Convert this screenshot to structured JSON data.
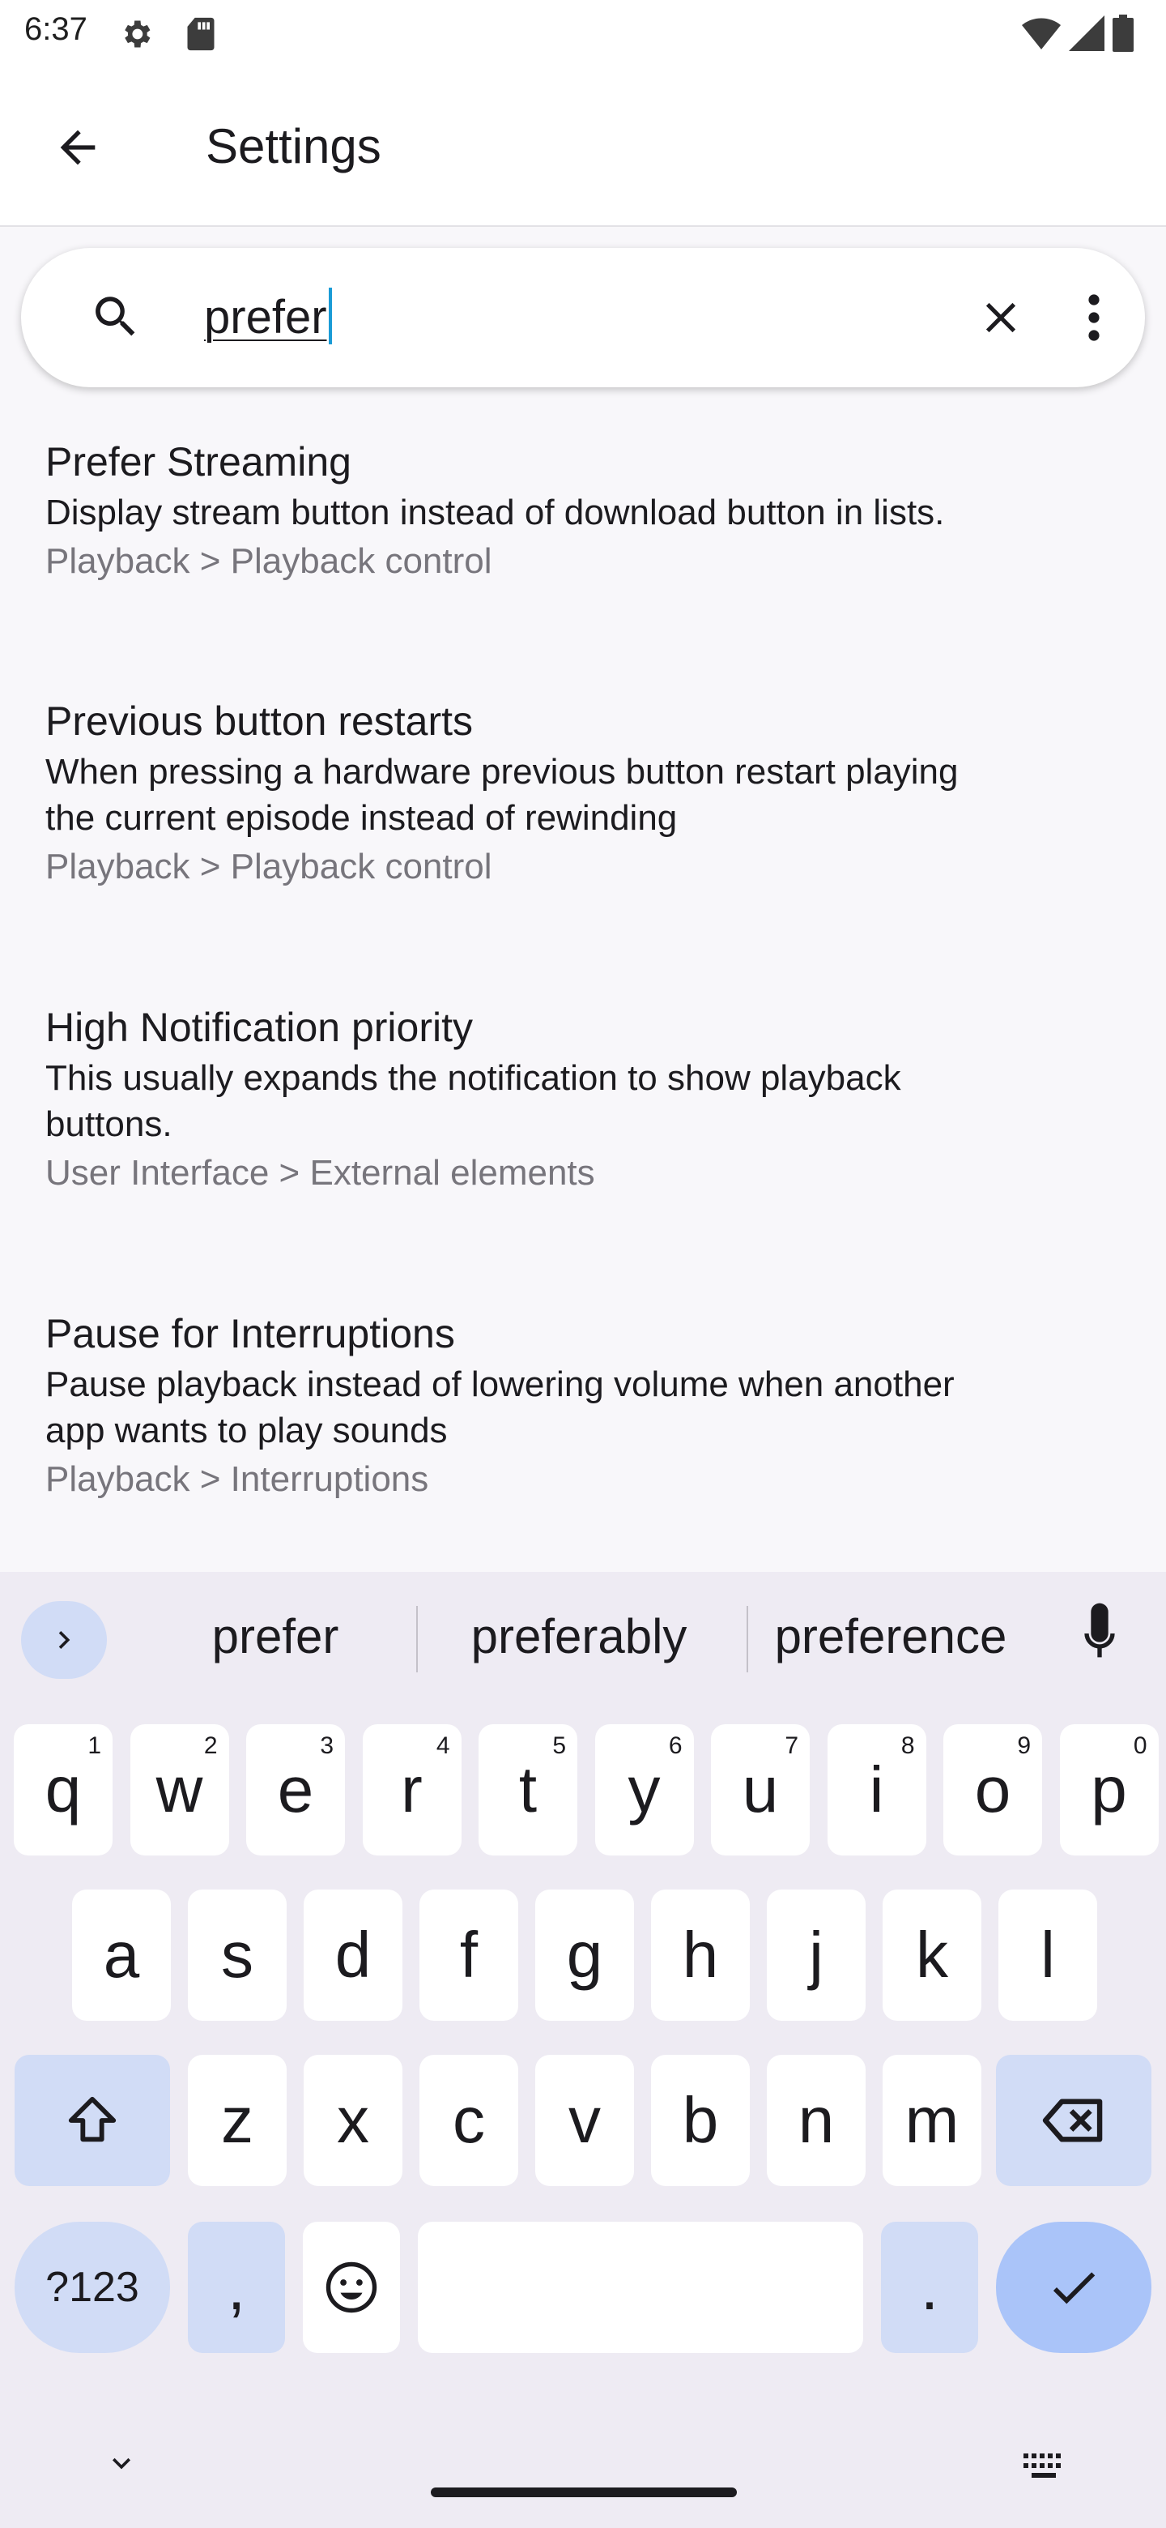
{
  "status_bar": {
    "time": "6:37",
    "icons": [
      "gear-icon",
      "sd-card-icon",
      "wifi-icon",
      "signal-icon",
      "battery-icon"
    ]
  },
  "app_bar": {
    "title": "Settings",
    "back_icon": "arrow-back-icon"
  },
  "search": {
    "query": "prefer",
    "icons": [
      "search-icon",
      "close-icon",
      "more-vert-icon"
    ]
  },
  "results": [
    {
      "title": "Prefer Streaming",
      "summary_lines": [
        "Display stream button instead of download button in lists."
      ],
      "path": "Playback > Playback control"
    },
    {
      "title": "Previous button restarts",
      "summary_lines": [
        "When pressing a hardware previous button restart playing",
        "the current episode instead of rewinding"
      ],
      "path": "Playback > Playback control"
    },
    {
      "title": "High Notification priority",
      "summary_lines": [
        "This usually expands the notification to show playback",
        "buttons."
      ],
      "path": "User Interface > External elements"
    },
    {
      "title": "Pause for Interruptions",
      "summary_lines": [
        "Pause playback instead of lowering volume when another",
        "app wants to play sounds"
      ],
      "path": "Playback > Interruptions"
    }
  ],
  "keyboard": {
    "suggestions": [
      "prefer",
      "preferably",
      "preference"
    ],
    "row1": [
      {
        "key": "q",
        "hint": "1"
      },
      {
        "key": "w",
        "hint": "2"
      },
      {
        "key": "e",
        "hint": "3"
      },
      {
        "key": "r",
        "hint": "4"
      },
      {
        "key": "t",
        "hint": "5"
      },
      {
        "key": "y",
        "hint": "6"
      },
      {
        "key": "u",
        "hint": "7"
      },
      {
        "key": "i",
        "hint": "8"
      },
      {
        "key": "o",
        "hint": "9"
      },
      {
        "key": "p",
        "hint": "0"
      }
    ],
    "row2": [
      "a",
      "s",
      "d",
      "f",
      "g",
      "h",
      "j",
      "k",
      "l"
    ],
    "row3": [
      "z",
      "x",
      "c",
      "v",
      "b",
      "n",
      "m"
    ],
    "symbols_label": "?123",
    "comma_label": ",",
    "period_label": ".",
    "colors": {
      "background": "#eeebf3",
      "accent": "#d1dcf6",
      "enter": "#aac4f9"
    }
  }
}
